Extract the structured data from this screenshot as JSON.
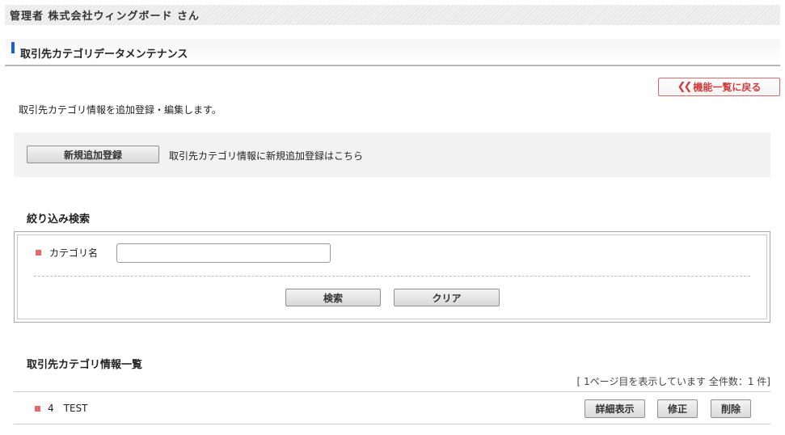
{
  "banner": {
    "text": "管理者 株式会社ウィングボード さん"
  },
  "page": {
    "title": "取引先カテゴリデータメンテナンス"
  },
  "back_button": {
    "label": "機能一覧に戻る",
    "icon": "double-chevron-left-icon"
  },
  "description": "取引先カテゴリ情報を追加登録・編集します。",
  "new_panel": {
    "button_label": "新規追加登録",
    "hint": "取引先カテゴリ情報に新規追加登録はこちら"
  },
  "search": {
    "title": "絞り込み検索",
    "category_label": "カテゴリ名",
    "category_value": "",
    "search_label": "検索",
    "clear_label": "クリア"
  },
  "list": {
    "title": "取引先カテゴリ情報一覧",
    "page_info": "[ 1ページ目を表示しています 全件数：1 件]",
    "rows": [
      {
        "id": "4",
        "name": "TEST",
        "detail_label": "詳細表示",
        "edit_label": "修正",
        "delete_label": "削除"
      }
    ]
  },
  "colors": {
    "accent": "#1a5fd0",
    "bullet": "#e56a6a",
    "back_text": "#d23c3c"
  }
}
